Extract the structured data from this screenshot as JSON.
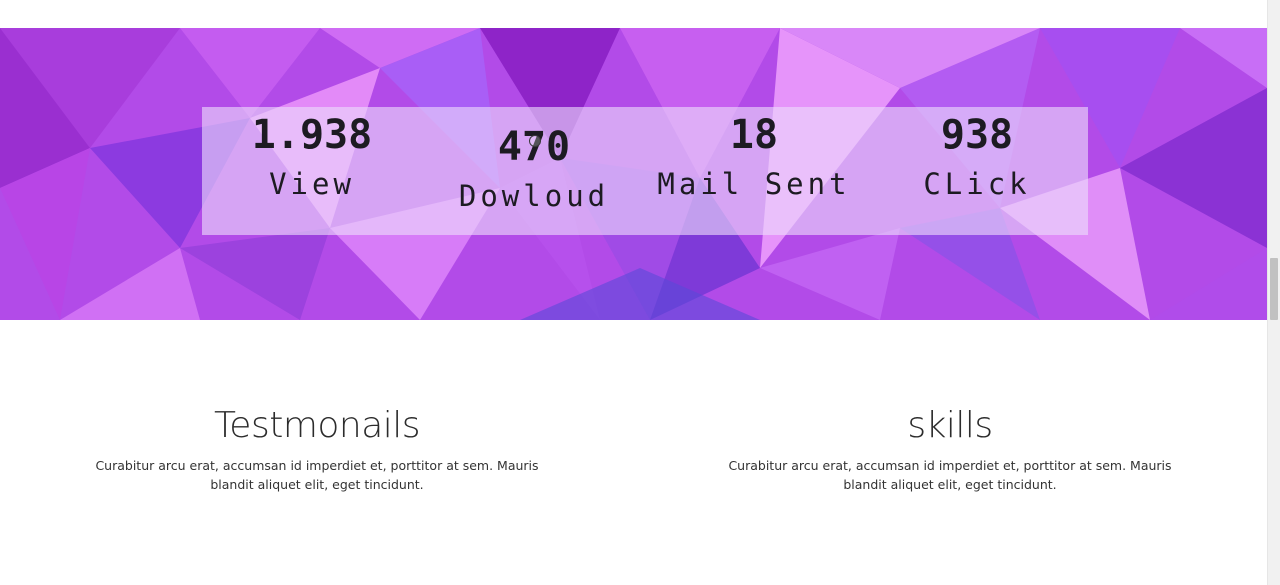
{
  "stats": [
    {
      "value": "1.938",
      "label": "View"
    },
    {
      "value": "470",
      "label": "Dowloud"
    },
    {
      "value": "18",
      "label": "Mail Sent"
    },
    {
      "value": "938",
      "label": "CLick"
    }
  ],
  "sections": [
    {
      "title": "Testmonails",
      "text": "Curabitur arcu erat, accumsan id imperdiet et, porttitor at sem. Mauris blandit aliquet elit, eget tincidunt."
    },
    {
      "title": "skills",
      "text": "Curabitur arcu erat, accumsan id imperdiet et, porttitor at sem. Mauris blandit aliquet elit, eget tincidunt."
    }
  ],
  "colors": {
    "band": "#b24be8",
    "panel": "#ecdcfc",
    "text": "#1d1b22"
  }
}
